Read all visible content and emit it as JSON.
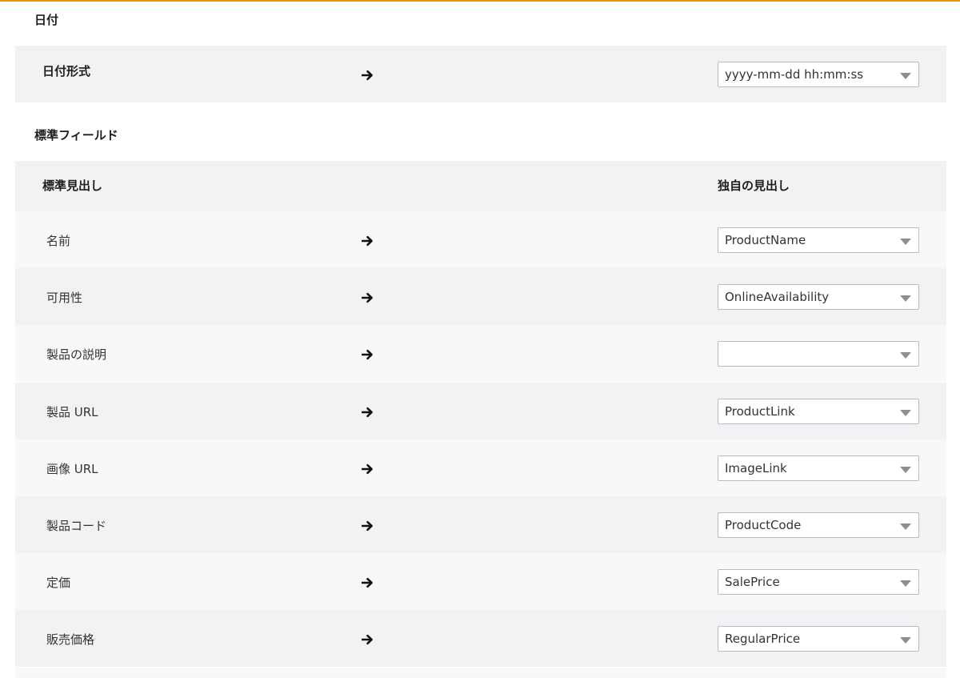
{
  "date_section": {
    "title": "日付",
    "row": {
      "label": "日付形式",
      "value": "yyyy-mm-dd hh:mm:ss"
    }
  },
  "standard_fields": {
    "title": "標準フィールド",
    "header": {
      "left": "標準見出し",
      "right": "独自の見出し"
    },
    "rows": [
      {
        "label": "名前",
        "value": "ProductName"
      },
      {
        "label": "可用性",
        "value": "OnlineAvailability"
      },
      {
        "label": "製品の説明",
        "value": ""
      },
      {
        "label": "製品 URL",
        "value": "ProductLink"
      },
      {
        "label": "画像 URL",
        "value": "ImageLink"
      },
      {
        "label": "製品コード",
        "value": "ProductCode"
      },
      {
        "label": "定価",
        "value": "SalePrice"
      },
      {
        "label": "販売価格",
        "value": "RegularPrice"
      }
    ]
  },
  "icons": {
    "arrow": "arrow-right-icon",
    "caret": "caret-down-icon"
  },
  "colors": {
    "accent": "#f0900a",
    "band": "#f1f2f4",
    "band_alt": "#f7f8f9"
  }
}
